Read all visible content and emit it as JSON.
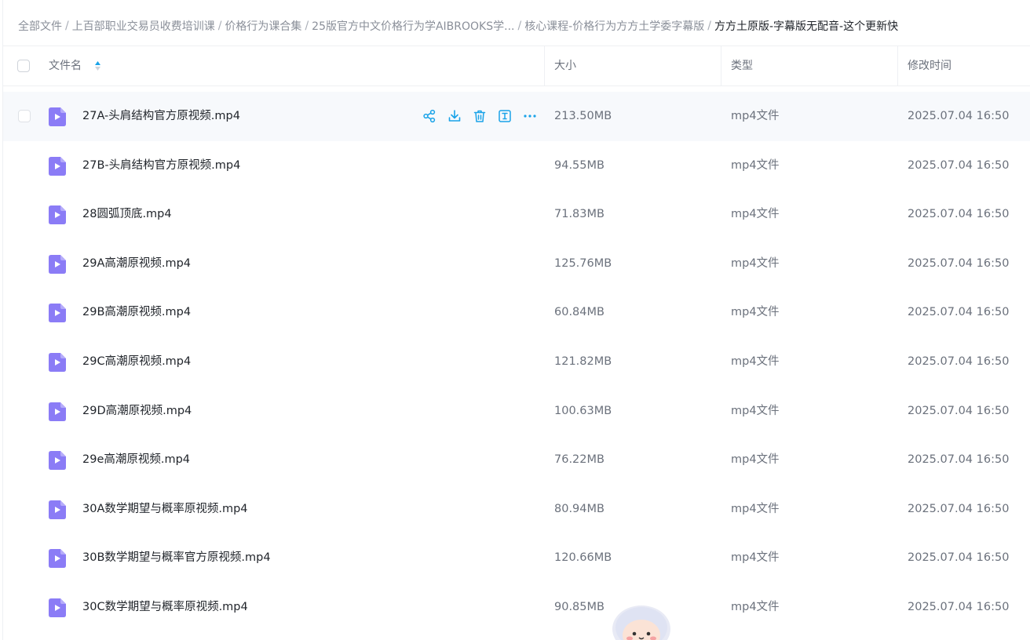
{
  "breadcrumb": [
    "全部文件",
    "上百部职业交易员收费培训课",
    "价格行为课合集",
    "25版官方中文价格行为学AIBROOKS学...",
    "核心课程-价格行为方方土学委字幕版",
    "方方土原版-字幕版无配音-这个更新快"
  ],
  "breadcrumb_separator": "/",
  "columns": {
    "name": "文件名",
    "size": "大小",
    "type": "类型",
    "modified": "修改时间"
  },
  "sort": {
    "column": "name",
    "direction": "ascending"
  },
  "hover_row_index": 0,
  "row_actions": [
    "share-icon",
    "download-icon",
    "delete-icon",
    "rename-icon",
    "more-icon"
  ],
  "accent_color": "#1aa3e8",
  "file_icon_color": "#8b7cf6",
  "files": [
    {
      "name": "27A-头肩结构官方原视频.mp4",
      "size": "213.50MB",
      "type": "mp4文件",
      "modified": "2025.07.04 16:50"
    },
    {
      "name": "27B-头肩结构官方原视频.mp4",
      "size": "94.55MB",
      "type": "mp4文件",
      "modified": "2025.07.04 16:50"
    },
    {
      "name": "28圆弧顶底.mp4",
      "size": "71.83MB",
      "type": "mp4文件",
      "modified": "2025.07.04 16:50"
    },
    {
      "name": "29A高潮原视频.mp4",
      "size": "125.76MB",
      "type": "mp4文件",
      "modified": "2025.07.04 16:50"
    },
    {
      "name": "29B高潮原视频.mp4",
      "size": "60.84MB",
      "type": "mp4文件",
      "modified": "2025.07.04 16:50"
    },
    {
      "name": "29C高潮原视频.mp4",
      "size": "121.82MB",
      "type": "mp4文件",
      "modified": "2025.07.04 16:50"
    },
    {
      "name": "29D高潮原视频.mp4",
      "size": "100.63MB",
      "type": "mp4文件",
      "modified": "2025.07.04 16:50"
    },
    {
      "name": "29e高潮原视频.mp4",
      "size": "76.22MB",
      "type": "mp4文件",
      "modified": "2025.07.04 16:50"
    },
    {
      "name": "30A数学期望与概率原视频.mp4",
      "size": "80.94MB",
      "type": "mp4文件",
      "modified": "2025.07.04 16:50"
    },
    {
      "name": "30B数学期望与概率官方原视频.mp4",
      "size": "120.66MB",
      "type": "mp4文件",
      "modified": "2025.07.04 16:50"
    },
    {
      "name": "30C数学期望与概率原视频.mp4",
      "size": "90.85MB",
      "type": "mp4文件",
      "modified": "2025.07.04 16:50"
    }
  ]
}
